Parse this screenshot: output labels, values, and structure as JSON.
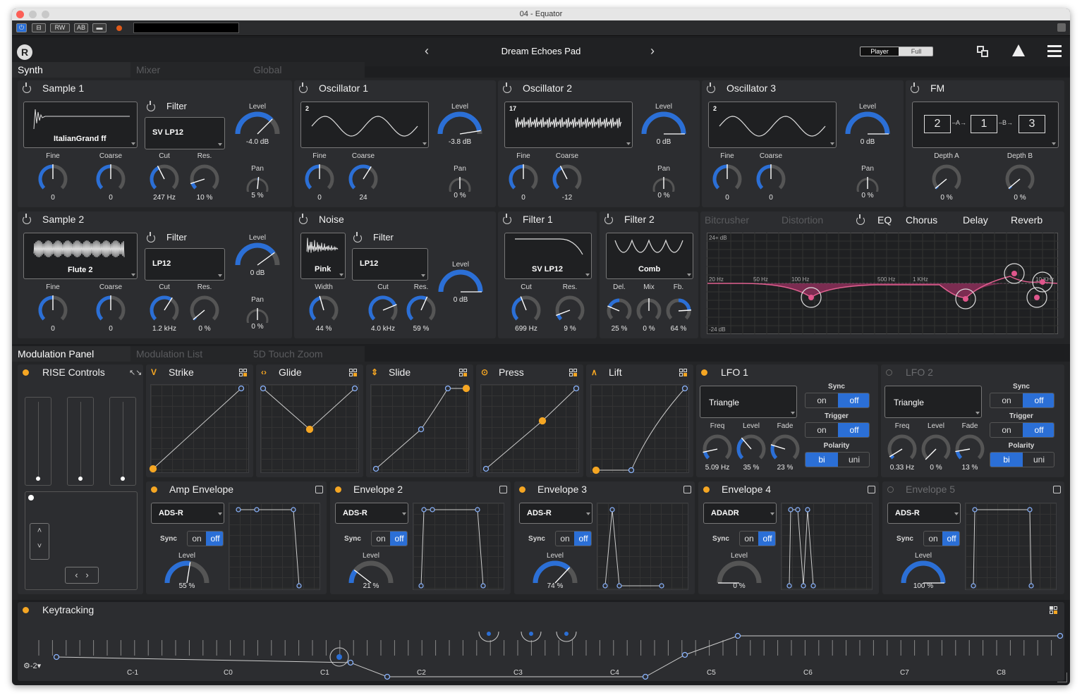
{
  "window": {
    "title": "04 - Equator"
  },
  "top": {
    "preset": "Dream Echoes Pad",
    "player": "Player",
    "full": "Full"
  },
  "tabs": {
    "synth": "Synth",
    "mixer": "Mixer",
    "global": "Global",
    "mod_panel": "Modulation Panel",
    "mod_list": "Modulation List",
    "touch_zoom": "5D Touch Zoom"
  },
  "sample1": {
    "title": "Sample 1",
    "wave": "ItalianGrand ff",
    "filter_title": "Filter",
    "filter": "SV LP12",
    "level_lbl": "Level",
    "level": "-4.0 dB",
    "fine_lbl": "Fine",
    "fine": "0",
    "coarse_lbl": "Coarse",
    "coarse": "0",
    "cut_lbl": "Cut",
    "cut": "247 Hz",
    "res_lbl": "Res.",
    "res": "10 %",
    "pan_lbl": "Pan",
    "pan": "5 %"
  },
  "osc1": {
    "title": "Oscillator 1",
    "num": "2",
    "level_lbl": "Level",
    "level": "-3.8 dB",
    "fine_lbl": "Fine",
    "fine": "0",
    "coarse_lbl": "Coarse",
    "coarse": "24",
    "pan_lbl": "Pan",
    "pan": "0 %"
  },
  "osc2": {
    "title": "Oscillator 2",
    "num": "17",
    "level_lbl": "Level",
    "level": "0 dB",
    "fine_lbl": "Fine",
    "fine": "0",
    "coarse_lbl": "Coarse",
    "coarse": "-12",
    "pan_lbl": "Pan",
    "pan": "0 %"
  },
  "osc3": {
    "title": "Oscillator 3",
    "num": "2",
    "level_lbl": "Level",
    "level": "0 dB",
    "fine_lbl": "Fine",
    "fine": "0",
    "coarse_lbl": "Coarse",
    "coarse": "0",
    "pan_lbl": "Pan",
    "pan": "0 %"
  },
  "fm": {
    "title": "FM",
    "a": "2",
    "b": "1",
    "c": "3",
    "la": "A",
    "lb": "B",
    "deptha_lbl": "Depth A",
    "deptha": "0 %",
    "depthb_lbl": "Depth B",
    "depthb": "0 %"
  },
  "sample2": {
    "title": "Sample 2",
    "wave": "Flute 2",
    "filter_title": "Filter",
    "filter": "LP12",
    "level_lbl": "Level",
    "level": "0 dB",
    "fine_lbl": "Fine",
    "fine": "0",
    "coarse_lbl": "Coarse",
    "coarse": "0",
    "cut_lbl": "Cut",
    "cut": "1.2 kHz",
    "res_lbl": "Res.",
    "res": "0 %",
    "pan_lbl": "Pan",
    "pan": "0 %"
  },
  "noise": {
    "title": "Noise",
    "type": "Pink",
    "filter_title": "Filter",
    "filter": "LP12",
    "level_lbl": "Level",
    "level": "0 dB",
    "width_lbl": "Width",
    "width": "44 %",
    "cut_lbl": "Cut",
    "cut": "4.0 kHz",
    "res_lbl": "Res.",
    "res": "59 %"
  },
  "filter1": {
    "title": "Filter 1",
    "type": "SV LP12",
    "cut_lbl": "Cut",
    "cut": "699 Hz",
    "res_lbl": "Res.",
    "res": "9 %"
  },
  "filter2": {
    "title": "Filter 2",
    "type": "Comb",
    "del_lbl": "Del.",
    "del": "25 %",
    "mix_lbl": "Mix",
    "mix": "0 %",
    "fb_lbl": "Fb.",
    "fb": "64 %"
  },
  "fx": {
    "bitcrusher": "Bitcrusher",
    "distortion": "Distortion",
    "eq": "EQ",
    "chorus": "Chorus",
    "delay": "Delay",
    "reverb": "Reverb",
    "db_top": "24+ dB",
    "db_bot": "-24 dB",
    "f1": "20 Hz",
    "f2": "50 Hz",
    "f3": "100 Hz",
    "f4": "500 Hz",
    "f5": "1 KHz",
    "f6": "10 KHz"
  },
  "rise": {
    "title": "RISE Controls"
  },
  "strike": {
    "title": "Strike"
  },
  "glide": {
    "title": "Glide"
  },
  "slide": {
    "title": "Slide"
  },
  "press": {
    "title": "Press"
  },
  "lift": {
    "title": "Lift"
  },
  "lfo1": {
    "title": "LFO 1",
    "shape": "Triangle",
    "sync_lbl": "Sync",
    "trigger_lbl": "Trigger",
    "polarity_lbl": "Polarity",
    "on": "on",
    "off": "off",
    "bi": "bi",
    "uni": "uni",
    "freq_lbl": "Freq",
    "freq": "5.09 Hz",
    "level_lbl": "Level",
    "level": "35 %",
    "fade_lbl": "Fade",
    "fade": "23 %"
  },
  "lfo2": {
    "title": "LFO 2",
    "shape": "Triangle",
    "sync_lbl": "Sync",
    "trigger_lbl": "Trigger",
    "polarity_lbl": "Polarity",
    "on": "on",
    "off": "off",
    "bi": "bi",
    "uni": "uni",
    "freq_lbl": "Freq",
    "freq": "0.33 Hz",
    "level_lbl": "Level",
    "level": "0 %",
    "fade_lbl": "Fade",
    "fade": "13 %"
  },
  "env": [
    {
      "title": "Amp Envelope",
      "mode": "ADS-R",
      "sync": "Sync",
      "on": "on",
      "off": "off",
      "level_lbl": "Level",
      "level": "55 %"
    },
    {
      "title": "Envelope 2",
      "mode": "ADS-R",
      "sync": "Sync",
      "on": "on",
      "off": "off",
      "level_lbl": "Level",
      "level": "21 %"
    },
    {
      "title": "Envelope 3",
      "mode": "ADS-R",
      "sync": "Sync",
      "on": "on",
      "off": "off",
      "level_lbl": "Level",
      "level": "74 %"
    },
    {
      "title": "Envelope 4",
      "mode": "ADADR",
      "sync": "Sync",
      "on": "on",
      "off": "off",
      "level_lbl": "Level",
      "level": "0 %"
    },
    {
      "title": "Envelope 5",
      "mode": "ADS-R",
      "sync": "Sync",
      "on": "on",
      "off": "off",
      "level_lbl": "Level",
      "level": "100 %"
    }
  ],
  "key": {
    "title": "Keytracking",
    "notes": [
      "C-1",
      "C0",
      "C1",
      "C2",
      "C3",
      "C4",
      "C5",
      "C6",
      "C7",
      "C8"
    ],
    "oct": "-2"
  },
  "colors": {
    "accent": "#2b6fd6",
    "orange": "#f5a623",
    "eq": "#c0427a",
    "panel": "#2c2d30"
  }
}
